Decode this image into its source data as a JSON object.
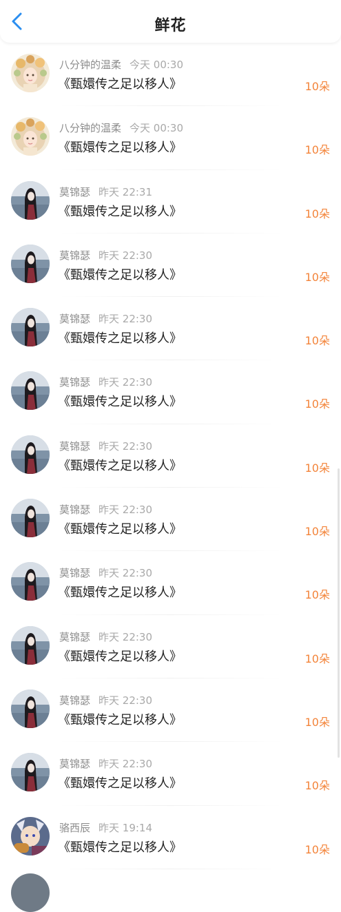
{
  "header": {
    "title": "鲜花",
    "back_icon": "chevron-left-icon",
    "accent": "#2b8ef0"
  },
  "list": [
    {
      "name": "八分钟的温柔",
      "time": "今天 00:30",
      "book": "《甄嬛传之足以移人》",
      "count": "10朵",
      "avatar": "flower-girl"
    },
    {
      "name": "八分钟的温柔",
      "time": "今天 00:30",
      "book": "《甄嬛传之足以移人》",
      "count": "10朵",
      "avatar": "flower-girl"
    },
    {
      "name": "莫锦瑟",
      "time": "昨天 22:31",
      "book": "《甄嬛传之足以移人》",
      "count": "10朵",
      "avatar": "seaside-girl"
    },
    {
      "name": "莫锦瑟",
      "time": "昨天 22:30",
      "book": "《甄嬛传之足以移人》",
      "count": "10朵",
      "avatar": "seaside-girl"
    },
    {
      "name": "莫锦瑟",
      "time": "昨天 22:30",
      "book": "《甄嬛传之足以移人》",
      "count": "10朵",
      "avatar": "seaside-girl"
    },
    {
      "name": "莫锦瑟",
      "time": "昨天 22:30",
      "book": "《甄嬛传之足以移人》",
      "count": "10朵",
      "avatar": "seaside-girl"
    },
    {
      "name": "莫锦瑟",
      "time": "昨天 22:30",
      "book": "《甄嬛传之足以移人》",
      "count": "10朵",
      "avatar": "seaside-girl"
    },
    {
      "name": "莫锦瑟",
      "time": "昨天 22:30",
      "book": "《甄嬛传之足以移人》",
      "count": "10朵",
      "avatar": "seaside-girl"
    },
    {
      "name": "莫锦瑟",
      "time": "昨天 22:30",
      "book": "《甄嬛传之足以移人》",
      "count": "10朵",
      "avatar": "seaside-girl"
    },
    {
      "name": "莫锦瑟",
      "time": "昨天 22:30",
      "book": "《甄嬛传之足以移人》",
      "count": "10朵",
      "avatar": "seaside-girl"
    },
    {
      "name": "莫锦瑟",
      "time": "昨天 22:30",
      "book": "《甄嬛传之足以移人》",
      "count": "10朵",
      "avatar": "seaside-girl"
    },
    {
      "name": "莫锦瑟",
      "time": "昨天 22:30",
      "book": "《甄嬛传之足以移人》",
      "count": "10朵",
      "avatar": "seaside-girl"
    },
    {
      "name": "骆西辰",
      "time": "昨天 19:14",
      "book": "《甄嬛传之足以移人》",
      "count": "10朵",
      "avatar": "game-character"
    }
  ],
  "colors": {
    "count": "#f3843a",
    "name": "#8d8d8d",
    "book": "#232323"
  }
}
